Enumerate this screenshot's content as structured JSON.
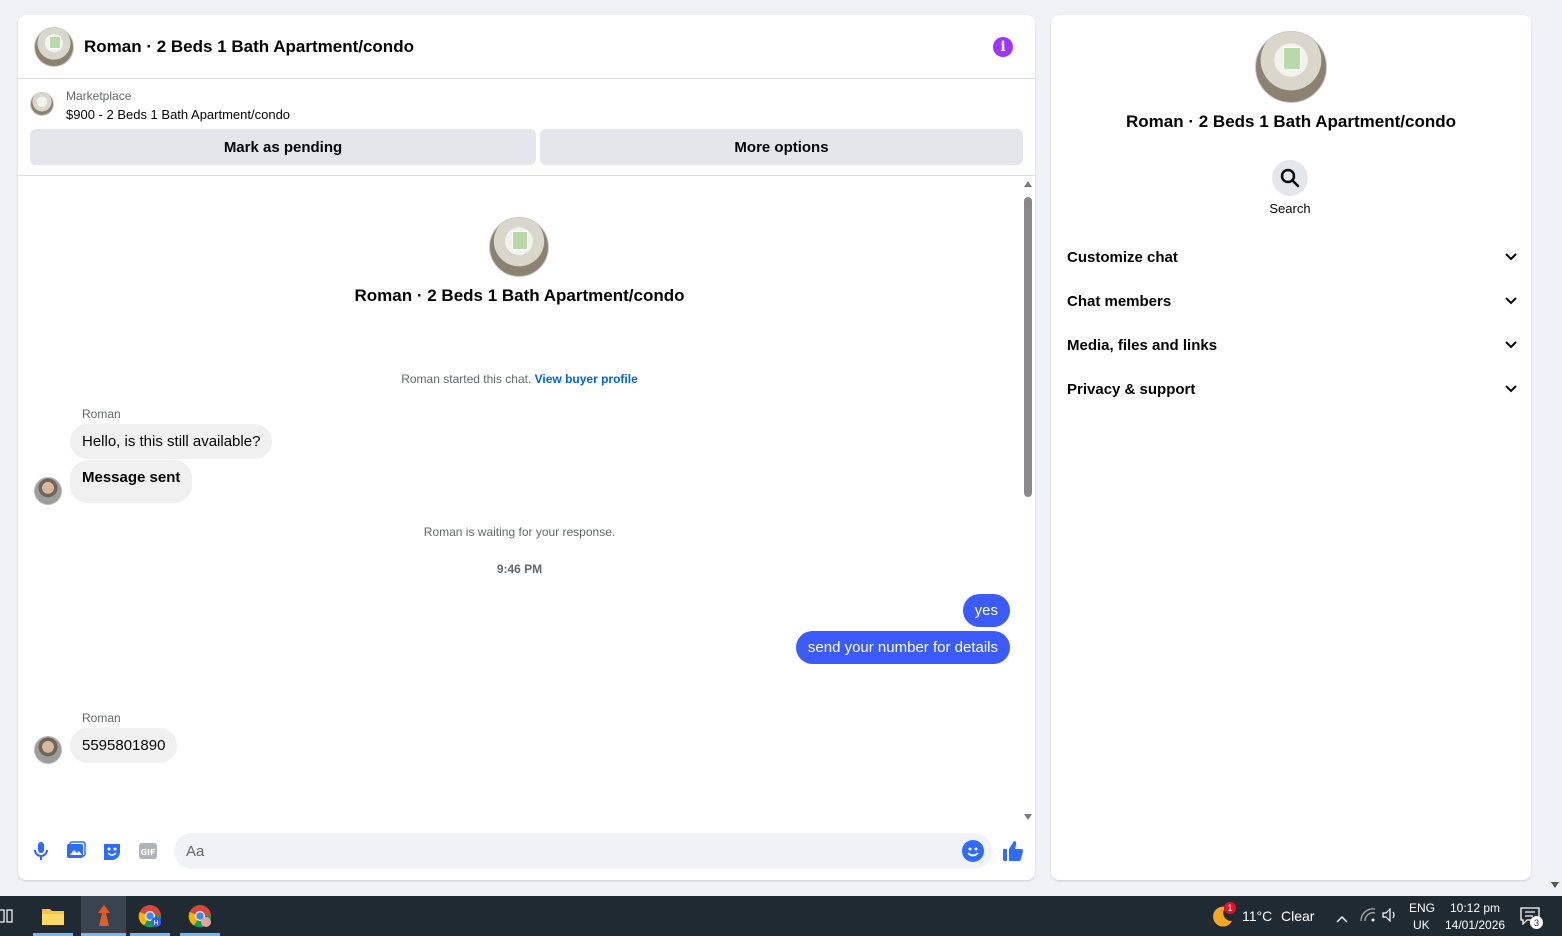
{
  "chat": {
    "title": "Roman · 2 Beds 1 Bath Apartment/condo",
    "listing_source": "Marketplace",
    "listing_title": "$900 - 2 Beds 1 Bath Apartment/condo",
    "mark_pending_label": "Mark as pending",
    "more_options_label": "More options",
    "intro_title": "Roman · 2 Beds 1 Bath Apartment/condo",
    "started_text": "Roman started this chat.",
    "view_buyer_profile": "View buyer profile",
    "waiting_text": "Roman is waiting for your response.",
    "timestamp": "9:46 PM",
    "messages": [
      {
        "sender": "Roman",
        "text": "Hello, is this still available?"
      },
      {
        "text": "Message sent"
      },
      {
        "text": "yes"
      },
      {
        "text": "send your number for details"
      },
      {
        "sender": "Roman",
        "text": "5595801890"
      }
    ],
    "composer_placeholder": "Aa"
  },
  "panel": {
    "title": "Roman · 2 Beds 1 Bath Apartment/condo",
    "search_label": "Search",
    "sections": [
      "Customize chat",
      "Chat members",
      "Media, files and links",
      "Privacy & support"
    ]
  },
  "taskbar": {
    "weather_temp": "11°C",
    "weather_text": "Clear",
    "weather_badge": "1",
    "lang_top": "ENG",
    "lang_bottom": "UK",
    "time": "10:12 pm",
    "date": "14/01/2026",
    "notif_count": "3"
  },
  "colors": {
    "accent_blue": "#3b5bfd",
    "info_purple": "#a033ff",
    "link_blue": "#0064d1"
  }
}
